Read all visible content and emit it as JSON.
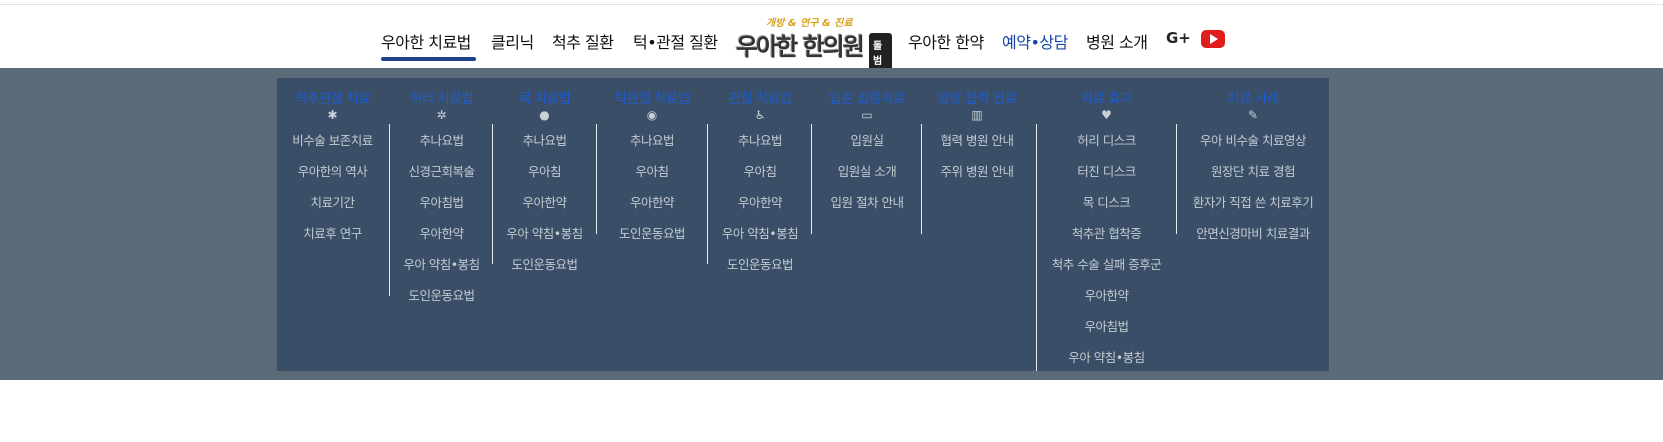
{
  "nav": {
    "items": [
      {
        "label": "우아한 치료법"
      },
      {
        "label": "클리닉"
      },
      {
        "label": "척추 질환"
      },
      {
        "label": "턱•관절 질환"
      },
      {
        "label": "우아한 한약"
      },
      {
        "label": "예약•상담"
      },
      {
        "label": "병원 소개"
      }
    ],
    "logo": {
      "tagline": "개방 & 연구 & 진료",
      "name": "우아한 한의원",
      "badge": "돌범"
    },
    "gplus_label": "G+",
    "youtube_icon": "youtube-icon",
    "active_color": "#1f3f8f",
    "accent_color": "#1747a6"
  },
  "mega_menu": {
    "columns": [
      {
        "heading": "척추관절 치료",
        "icon": "spine-icon",
        "items": [
          "비수술 보존치료",
          "우아한의 역사",
          "치료기간",
          "치료후 연구"
        ]
      },
      {
        "heading": "허리 치료법",
        "icon": "back-icon",
        "items": [
          "추나요법",
          "신경근회복술",
          "우아침법",
          "우아한약",
          "우아 약침•봉침",
          "도인운동요법"
        ]
      },
      {
        "heading": "목 치료법",
        "icon": "neck-icon",
        "items": [
          "추나요법",
          "우아침",
          "우아한약",
          "우아 약침•봉침",
          "도인운동요법"
        ]
      },
      {
        "heading": "턱관절 치료법",
        "icon": "jaw-icon",
        "items": [
          "추나요법",
          "우아침",
          "우아한약",
          "도인운동요법"
        ]
      },
      {
        "heading": "관절 치료법",
        "icon": "joint-icon",
        "items": [
          "추나요법",
          "우아침",
          "우아한약",
          "우아 약침•봉침",
          "도인운동요법"
        ]
      },
      {
        "heading": "입원 집중치료",
        "icon": "bed-icon",
        "items": [
          "입원실",
          "입원실 소개",
          "입원 절차 안내"
        ]
      },
      {
        "heading": "양방 협력 진료",
        "icon": "hospital-icon",
        "items": [
          "협력 병원 안내",
          "주위 병원 안내"
        ]
      },
      {
        "heading": "치료 효과",
        "icon": "care-icon",
        "items": [
          "허리 디스크",
          "터진 디스크",
          "목 디스크",
          "척추관 협착증",
          "척추 수술 실패 증후군",
          "우아한약",
          "우아침법",
          "우아 약침•봉침"
        ]
      },
      {
        "heading": "치료 사례",
        "icon": "note-icon",
        "items": [
          "우아 비수술 치료영상",
          "원장단 치료 경험",
          "환자가 직접 쓴 치료후기",
          "안면신경마비 치료결과"
        ]
      }
    ]
  }
}
